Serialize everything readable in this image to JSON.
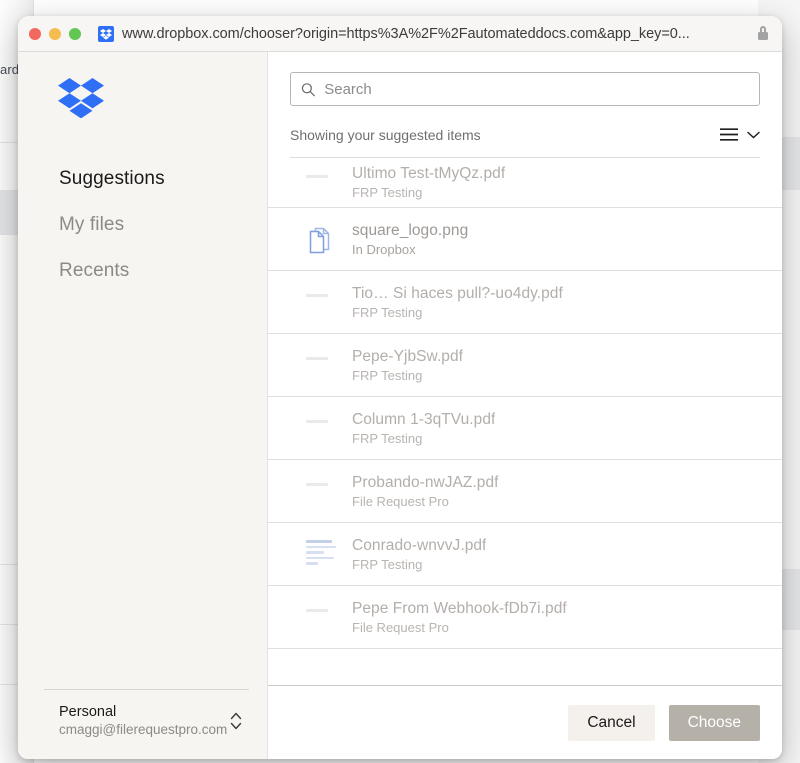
{
  "backdrop": {
    "partial_text": "ard"
  },
  "browser": {
    "url": "www.dropbox.com/chooser?origin=https%3A%2F%2Fautomateddocs.com&app_key=0...",
    "favicon": "dropbox-favicon",
    "lock": "lock-icon",
    "traffic_lights": [
      "close-red",
      "minimize-yellow",
      "maximize-green"
    ]
  },
  "sidebar": {
    "logo": "dropbox-logo",
    "items": [
      {
        "label": "Suggestions",
        "active": true
      },
      {
        "label": "My files",
        "active": false
      },
      {
        "label": "Recents",
        "active": false
      }
    ],
    "account": {
      "name": "Personal",
      "email": "cmaggi@filerequestpro.com",
      "switch_icon": "chevron-up-down-icon"
    }
  },
  "search": {
    "icon": "search-icon",
    "placeholder": "Search",
    "value": ""
  },
  "list_header": {
    "showing_text": "Showing your suggested items",
    "view_icon": "list-view-icon",
    "chevron_icon": "chevron-down-icon"
  },
  "files": [
    {
      "name": "Ultimo Test-tMyQz.pdf",
      "location": "FRP Testing",
      "icon": "faint-thumbnail",
      "clipped": true
    },
    {
      "name": "square_logo.png",
      "location": "In Dropbox",
      "icon": "documents-icon",
      "clipped": false
    },
    {
      "name": "Tio… Si haces pull?-uo4dy.pdf",
      "location": "FRP Testing",
      "icon": "faint-thumbnail",
      "clipped": false
    },
    {
      "name": "Pepe-YjbSw.pdf",
      "location": "FRP Testing",
      "icon": "faint-thumbnail",
      "clipped": false
    },
    {
      "name": "Column 1-3qTVu.pdf",
      "location": "FRP Testing",
      "icon": "faint-thumbnail",
      "clipped": false
    },
    {
      "name": "Probando-nwJAZ.pdf",
      "location": "File Request Pro",
      "icon": "faint-thumbnail",
      "clipped": false
    },
    {
      "name": "Conrado-wnvvJ.pdf",
      "location": "FRP Testing",
      "icon": "document-lines-icon",
      "clipped": false
    },
    {
      "name": "Pepe From Webhook-fDb7i.pdf",
      "location": "File Request Pro",
      "icon": "faint-thumbnail",
      "clipped": false
    }
  ],
  "footer": {
    "cancel_label": "Cancel",
    "choose_label": "Choose",
    "choose_disabled": true
  },
  "colors": {
    "dropbox_blue": "#2f6ff5",
    "sidebar_bg": "#f7f5f2",
    "choose_button": "#b5b0a8",
    "cancel_button": "#f4f1ec"
  }
}
